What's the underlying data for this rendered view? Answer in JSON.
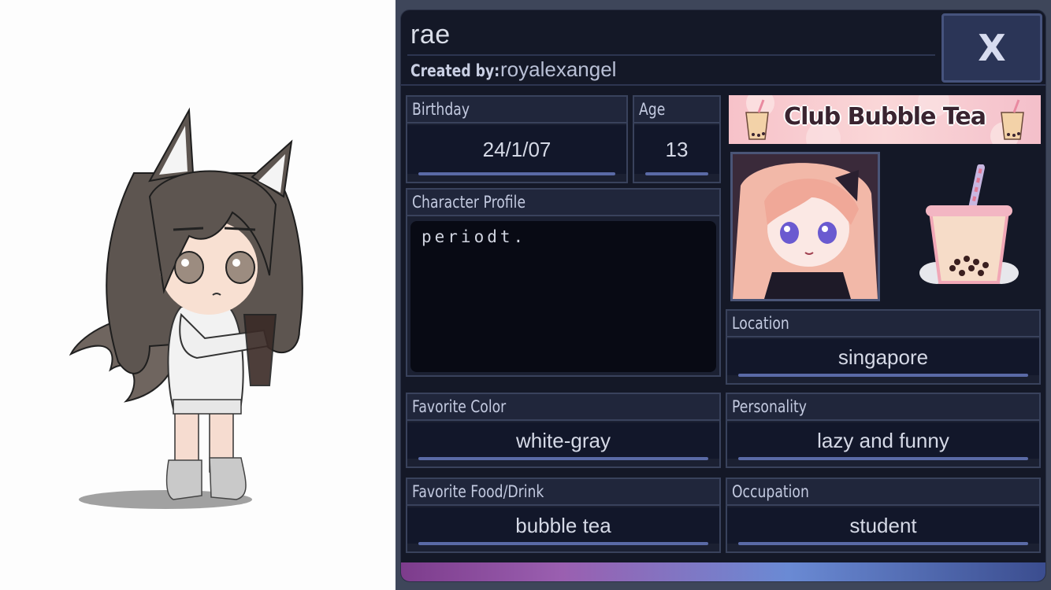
{
  "character": {
    "name": "rae",
    "created_by_label": "Created by:",
    "creator": "royalexangel"
  },
  "close_button": {
    "label": "X"
  },
  "fields": {
    "birthday": {
      "label": "Birthday",
      "value": "24/1/07"
    },
    "age": {
      "label": "Age",
      "value": "13"
    },
    "profile": {
      "label": "Character Profile",
      "value": "periodt."
    },
    "location": {
      "label": "Location",
      "value": "singapore"
    },
    "favorite_color": {
      "label": "Favorite Color",
      "value": "white-gray"
    },
    "personality": {
      "label": "Personality",
      "value": "lazy and funny"
    },
    "favorite_food": {
      "label": "Favorite Food/Drink",
      "value": "bubble tea"
    },
    "occupation": {
      "label": "Occupation",
      "value": "student"
    }
  },
  "banner": {
    "text": "Club Bubble Tea"
  },
  "icons": [
    "close-icon",
    "bubble-tea-icon",
    "avatar-portrait"
  ],
  "colors": {
    "panel_bg": "#141827",
    "field_bg": "#1b2032",
    "accent_underline": "#5a6aa6",
    "banner_pink": "#f7c2c9"
  }
}
